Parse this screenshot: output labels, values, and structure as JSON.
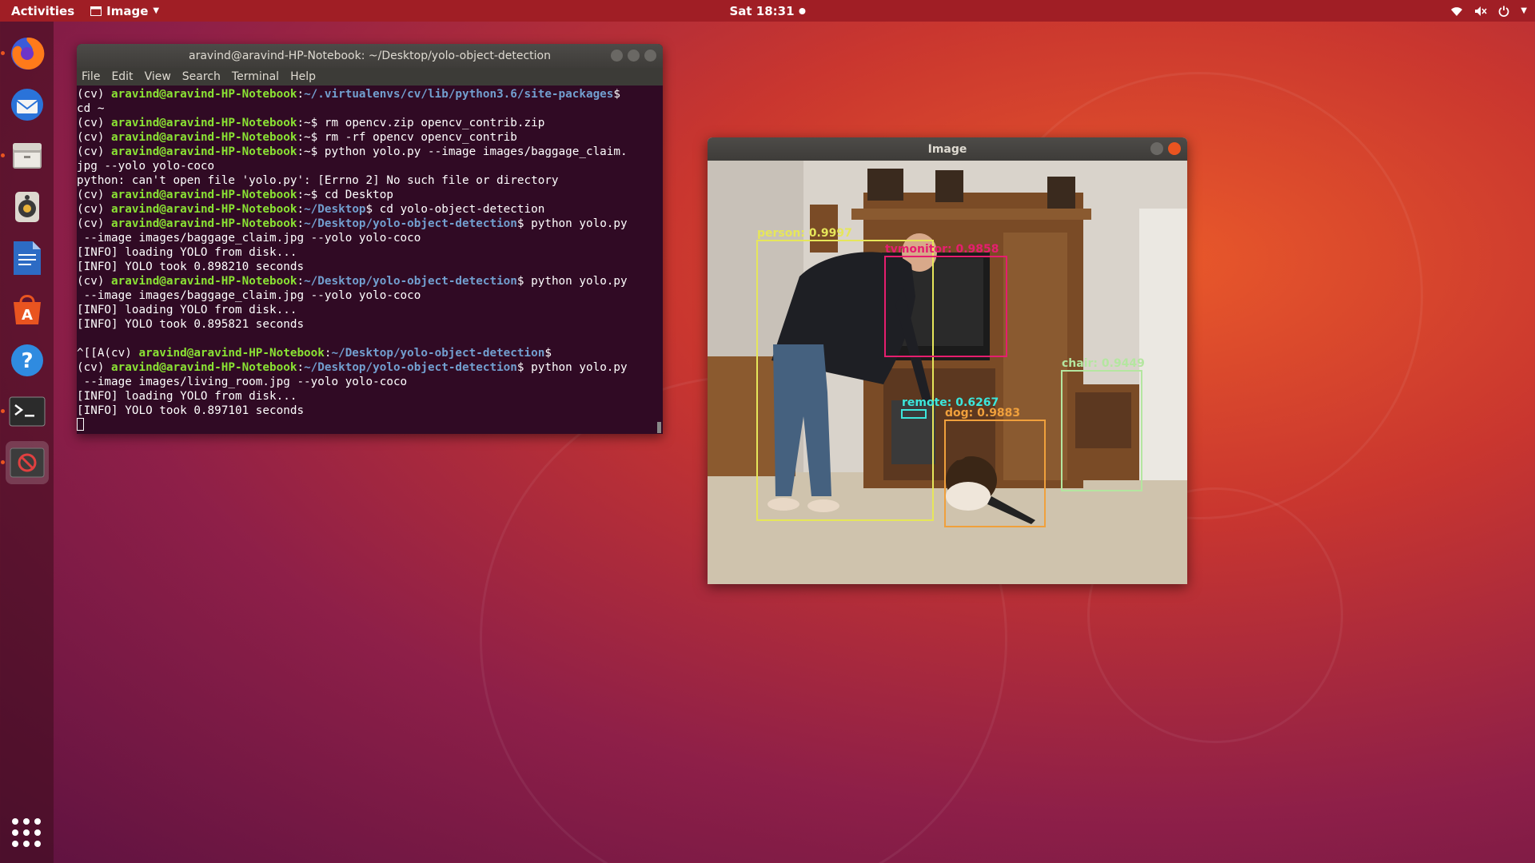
{
  "topbar": {
    "activities": "Activities",
    "app_name": "Image",
    "clock": "Sat 18:31"
  },
  "dock": {
    "items": [
      "firefox-icon",
      "thunderbird-icon",
      "files-icon",
      "rhythmbox-icon",
      "writer-icon",
      "software-icon",
      "help-icon",
      "terminal-icon",
      "image-app-icon"
    ]
  },
  "terminal": {
    "title": "aravind@aravind-HP-Notebook: ~/Desktop/yolo-object-detection",
    "menu": [
      "File",
      "Edit",
      "View",
      "Search",
      "Terminal",
      "Help"
    ],
    "lines": [
      {
        "p": "(cv) ",
        "u": "aravind@aravind-HP-Notebook",
        "c": ":",
        "d": "~/.virtualenvs/cv/lib/python3.6/site-packages",
        "t": "$"
      },
      {
        "p": "cd ~",
        "u": "",
        "c": "",
        "d": "",
        "t": ""
      },
      {
        "p": "(cv) ",
        "u": "aravind@aravind-HP-Notebook",
        "c": ":~",
        "d": "",
        "t": "$ rm opencv.zip opencv_contrib.zip"
      },
      {
        "p": "(cv) ",
        "u": "aravind@aravind-HP-Notebook",
        "c": ":~",
        "d": "",
        "t": "$ rm -rf opencv opencv_contrib"
      },
      {
        "p": "(cv) ",
        "u": "aravind@aravind-HP-Notebook",
        "c": ":~",
        "d": "",
        "t": "$ python yolo.py --image images/baggage_claim."
      },
      {
        "p": "jpg --yolo yolo-coco",
        "u": "",
        "c": "",
        "d": "",
        "t": ""
      },
      {
        "p": "python: can't open file 'yolo.py': [Errno 2] No such file or directory",
        "u": "",
        "c": "",
        "d": "",
        "t": ""
      },
      {
        "p": "(cv) ",
        "u": "aravind@aravind-HP-Notebook",
        "c": ":~",
        "d": "",
        "t": "$ cd Desktop"
      },
      {
        "p": "(cv) ",
        "u": "aravind@aravind-HP-Notebook",
        "c": ":",
        "d": "~/Desktop",
        "t": "$ cd yolo-object-detection"
      },
      {
        "p": "(cv) ",
        "u": "aravind@aravind-HP-Notebook",
        "c": ":",
        "d": "~/Desktop/yolo-object-detection",
        "t": "$ python yolo.py"
      },
      {
        "p": " --image images/baggage_claim.jpg --yolo yolo-coco",
        "u": "",
        "c": "",
        "d": "",
        "t": ""
      },
      {
        "p": "[INFO] loading YOLO from disk...",
        "u": "",
        "c": "",
        "d": "",
        "t": ""
      },
      {
        "p": "[INFO] YOLO took 0.898210 seconds",
        "u": "",
        "c": "",
        "d": "",
        "t": ""
      },
      {
        "p": "(cv) ",
        "u": "aravind@aravind-HP-Notebook",
        "c": ":",
        "d": "~/Desktop/yolo-object-detection",
        "t": "$ python yolo.py"
      },
      {
        "p": " --image images/baggage_claim.jpg --yolo yolo-coco",
        "u": "",
        "c": "",
        "d": "",
        "t": ""
      },
      {
        "p": "[INFO] loading YOLO from disk...",
        "u": "",
        "c": "",
        "d": "",
        "t": ""
      },
      {
        "p": "[INFO] YOLO took 0.895821 seconds",
        "u": "",
        "c": "",
        "d": "",
        "t": ""
      },
      {
        "p": "",
        "u": "",
        "c": "",
        "d": "",
        "t": ""
      },
      {
        "p": "^[[A(cv) ",
        "u": "aravind@aravind-HP-Notebook",
        "c": ":",
        "d": "~/Desktop/yolo-object-detection",
        "t": "$"
      },
      {
        "p": "(cv) ",
        "u": "aravind@aravind-HP-Notebook",
        "c": ":",
        "d": "~/Desktop/yolo-object-detection",
        "t": "$ python yolo.py"
      },
      {
        "p": " --image images/living_room.jpg --yolo yolo-coco",
        "u": "",
        "c": "",
        "d": "",
        "t": ""
      },
      {
        "p": "[INFO] loading YOLO from disk...",
        "u": "",
        "c": "",
        "d": "",
        "t": ""
      },
      {
        "p": "[INFO] YOLO took 0.897101 seconds",
        "u": "",
        "c": "",
        "d": "",
        "t": ""
      }
    ]
  },
  "image_window": {
    "title": "Image",
    "detections": [
      {
        "label": "person: 0.9997",
        "color": "#e6e65a"
      },
      {
        "label": "tvmonitor: 0.9858",
        "color": "#e61e6e"
      },
      {
        "label": "chair: 0.9449",
        "color": "#b4e6a0"
      },
      {
        "label": "remote: 0.6267",
        "color": "#3ce6dc"
      },
      {
        "label": "dog: 0.9883",
        "color": "#f0a03c"
      }
    ]
  },
  "colors": {
    "accent": "#e95420",
    "terminal_bg": "#300a24",
    "prompt_user": "#8ae234",
    "prompt_dir": "#729fcf"
  }
}
